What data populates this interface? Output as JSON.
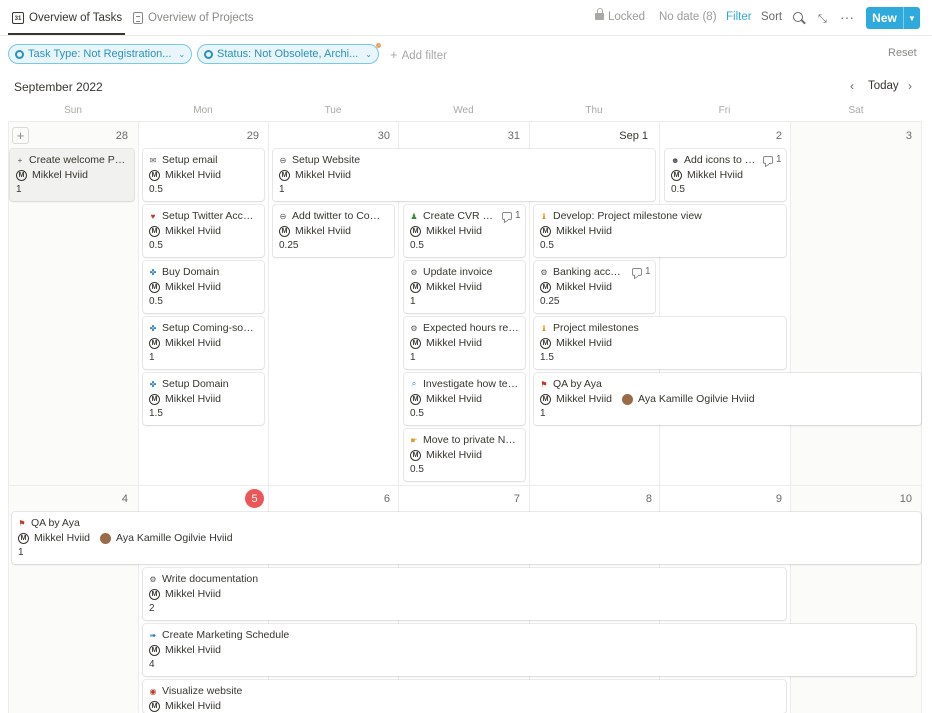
{
  "tabs": [
    {
      "label": "Overview of Tasks",
      "icon": "calendar-icon",
      "icon_text": "31",
      "active": true
    },
    {
      "label": "Overview of Projects",
      "icon": "page-icon",
      "active": false
    }
  ],
  "toolbar": {
    "locked": "Locked",
    "no_date": "No date (8)",
    "filter": "Filter",
    "sort": "Sort",
    "search_icon": "search-icon",
    "expand_icon": "expand-icon",
    "more": "···",
    "new_label": "New",
    "new_chevron": "▼"
  },
  "filters": {
    "pills": [
      {
        "label": "Task Type: Not Registration..."
      },
      {
        "label": "Status: Not Obsolete, Archi..."
      }
    ],
    "add_filter": "Add filter",
    "add_icon": "+",
    "caret": "⌄",
    "reset": "Reset"
  },
  "calendar": {
    "month": "September 2022",
    "nav_prev": "‹",
    "nav_today": "Today",
    "nav_next": "›",
    "weekdays": [
      "Sun",
      "Mon",
      "Tue",
      "Wed",
      "Thu",
      "Fri",
      "Sat"
    ],
    "week1_days": [
      "28",
      "29",
      "30",
      "31",
      "Sep 1",
      "2",
      "3"
    ],
    "week2_days": [
      "4",
      "5",
      "6",
      "7",
      "8",
      "9",
      "10"
    ],
    "today": "5",
    "add_icon": "+"
  },
  "person": "Mikkel Hviid",
  "person2": "Aya Kamille Ogilvie Hviid",
  "avatar_initial": "M",
  "cards": [
    {
      "title": "Create welcome Proj...",
      "emoji": "+",
      "value": "1"
    },
    {
      "title": "Setup email",
      "emoji": "✉",
      "value": "0.5"
    },
    {
      "title": "Setup Website",
      "emoji": "⊖",
      "value": "1"
    },
    {
      "title": "Add icons to te...",
      "emoji": "☻",
      "value": "0.5",
      "comments": "1"
    },
    {
      "title": "Setup Twitter Account",
      "emoji": "♥",
      "value": "0.5"
    },
    {
      "title": "Add twitter to Comi...",
      "emoji": "⊖",
      "value": "0.25"
    },
    {
      "title": "Create CVR Co...",
      "emoji": "♟",
      "value": "0.5",
      "comments": "1"
    },
    {
      "title": "Develop: Project milestone view",
      "emoji": "♝",
      "value": "0.5"
    },
    {
      "title": "Buy Domain",
      "emoji": "✤",
      "value": "0.5"
    },
    {
      "title": "Update invoice",
      "emoji": "⚙",
      "value": "1"
    },
    {
      "title": "Banking account",
      "emoji": "⚙",
      "value": "0.25",
      "comments": "1"
    },
    {
      "title": "Setup Coming-soon ...",
      "emoji": "✤",
      "value": "1"
    },
    {
      "title": "Expected hours rew...",
      "emoji": "⚙",
      "value": "1"
    },
    {
      "title": "Project milestones",
      "emoji": "♝",
      "value": "1.5"
    },
    {
      "title": "Setup Domain",
      "emoji": "✤",
      "value": "1.5"
    },
    {
      "title": "Investigate how tem...",
      "emoji": "⌕",
      "value": "0.5"
    },
    {
      "title": "QA by Aya",
      "emoji": "⚑",
      "value": "1"
    },
    {
      "title": "Move to private Noti...",
      "emoji": "☛",
      "value": "0.5"
    },
    {
      "title": "QA by Aya",
      "emoji": "⚑",
      "value": "1"
    },
    {
      "title": "Write documentation",
      "emoji": "⚙",
      "value": "2"
    },
    {
      "title": "Create Marketing Schedule",
      "emoji": "➠",
      "value": "4"
    },
    {
      "title": "Visualize website",
      "emoji": "◉",
      "value": ""
    }
  ]
}
